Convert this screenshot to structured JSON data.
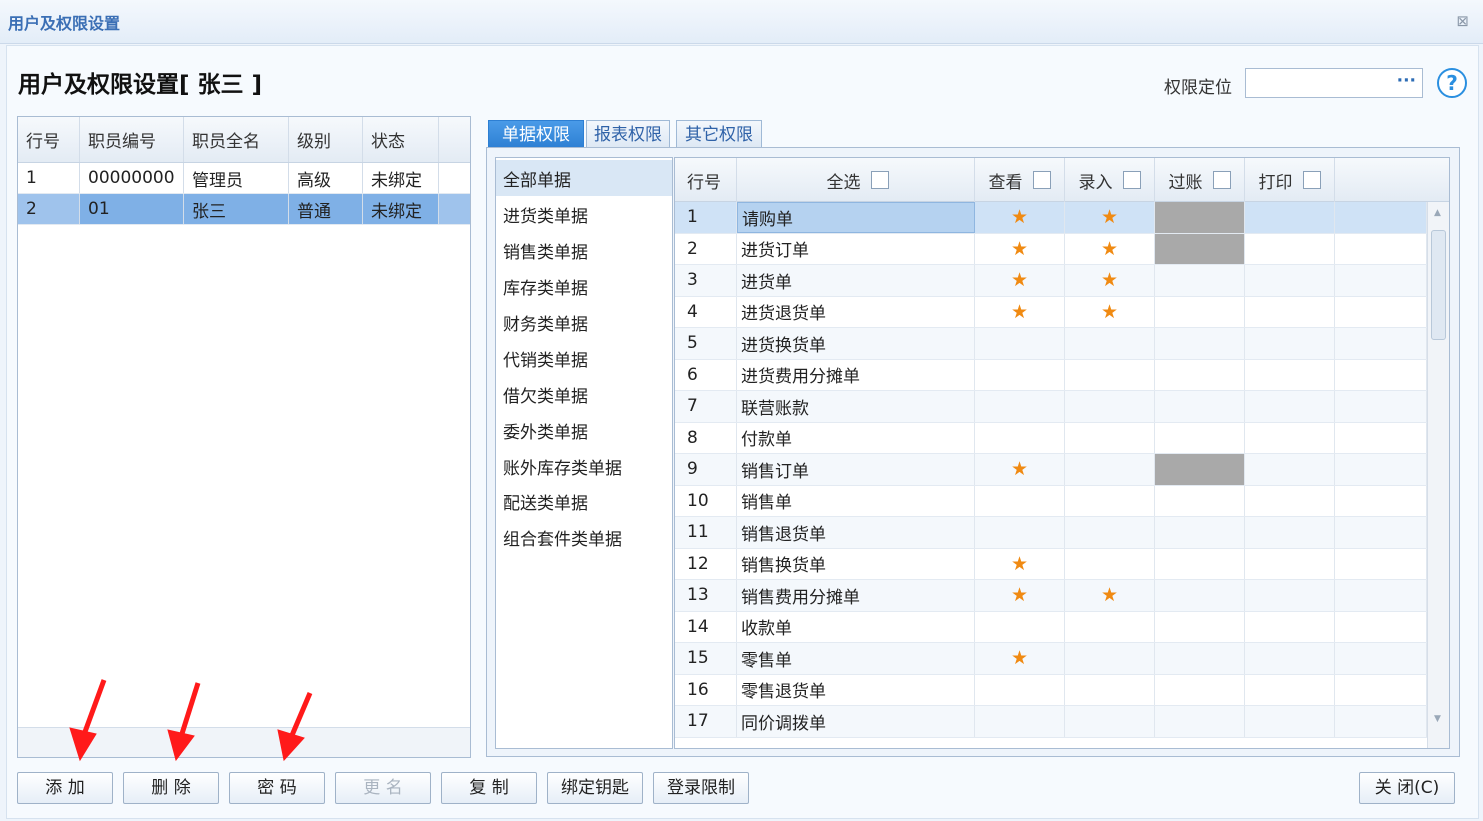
{
  "window": {
    "title": "用户及权限设置",
    "close_icon": "close-icon"
  },
  "dialog": {
    "heading": "用户及权限设置[ 张三 ]"
  },
  "locate": {
    "label": "权限定位",
    "value": "",
    "ellipsis": "···"
  },
  "help": {
    "symbol": "?"
  },
  "users": {
    "columns": [
      "行号",
      "职员编号",
      "职员全名",
      "级别",
      "状态"
    ],
    "rows": [
      {
        "no": "1",
        "code": "00000000",
        "name": "管理员",
        "level": "高级",
        "status": "未绑定"
      },
      {
        "no": "2",
        "code": "01",
        "name": "张三",
        "level": "普通",
        "status": "未绑定"
      }
    ]
  },
  "tabs": [
    "单据权限",
    "报表权限",
    "其它权限"
  ],
  "categories": [
    "全部单据",
    "进货类单据",
    "销售类单据",
    "库存类单据",
    "财务类单据",
    "代销类单据",
    "借欠类单据",
    "委外类单据",
    "账外库存类单据",
    "配送类单据",
    "组合套件类单据"
  ],
  "perm_header": {
    "no": "行号",
    "all": "全选",
    "view": "查看",
    "entry": "录入",
    "post": "过账",
    "print": "打印"
  },
  "perm_rows": [
    {
      "no": "1",
      "name": "请购单",
      "view": true,
      "entry": true,
      "post_gray": true
    },
    {
      "no": "2",
      "name": "进货订单",
      "view": true,
      "entry": true,
      "post_gray": true
    },
    {
      "no": "3",
      "name": "进货单",
      "view": true,
      "entry": true,
      "post_gray": false
    },
    {
      "no": "4",
      "name": "进货退货单",
      "view": true,
      "entry": true,
      "post_gray": false
    },
    {
      "no": "5",
      "name": "进货换货单",
      "view": false,
      "entry": false,
      "post_gray": false
    },
    {
      "no": "6",
      "name": "进货费用分摊单",
      "view": false,
      "entry": false,
      "post_gray": false
    },
    {
      "no": "7",
      "name": "联营账款",
      "view": false,
      "entry": false,
      "post_gray": false
    },
    {
      "no": "8",
      "name": "付款单",
      "view": false,
      "entry": false,
      "post_gray": false
    },
    {
      "no": "9",
      "name": "销售订单",
      "view": true,
      "entry": false,
      "post_gray": true
    },
    {
      "no": "10",
      "name": "销售单",
      "view": false,
      "entry": false,
      "post_gray": false
    },
    {
      "no": "11",
      "name": "销售退货单",
      "view": false,
      "entry": false,
      "post_gray": false
    },
    {
      "no": "12",
      "name": "销售换货单",
      "view": true,
      "entry": false,
      "post_gray": false
    },
    {
      "no": "13",
      "name": "销售费用分摊单",
      "view": true,
      "entry": true,
      "post_gray": false
    },
    {
      "no": "14",
      "name": "收款单",
      "view": false,
      "entry": false,
      "post_gray": false
    },
    {
      "no": "15",
      "name": "零售单",
      "view": true,
      "entry": false,
      "post_gray": false
    },
    {
      "no": "16",
      "name": "零售退货单",
      "view": false,
      "entry": false,
      "post_gray": false
    },
    {
      "no": "17",
      "name": "同价调拨单",
      "view": false,
      "entry": false,
      "post_gray": false
    }
  ],
  "star_symbol": "★",
  "buttons": {
    "add": "添 加",
    "delete": "删 除",
    "password": "密 码",
    "rename": "更 名",
    "copy": "复 制",
    "bind_key": "绑定钥匙",
    "login_limit": "登录限制",
    "close": "关 闭(C)"
  },
  "colors": {
    "accent": "#2d7fd3",
    "star": "#f08a12",
    "selected_row": "#9fc3ec",
    "arrow": "#ff1a1a"
  }
}
